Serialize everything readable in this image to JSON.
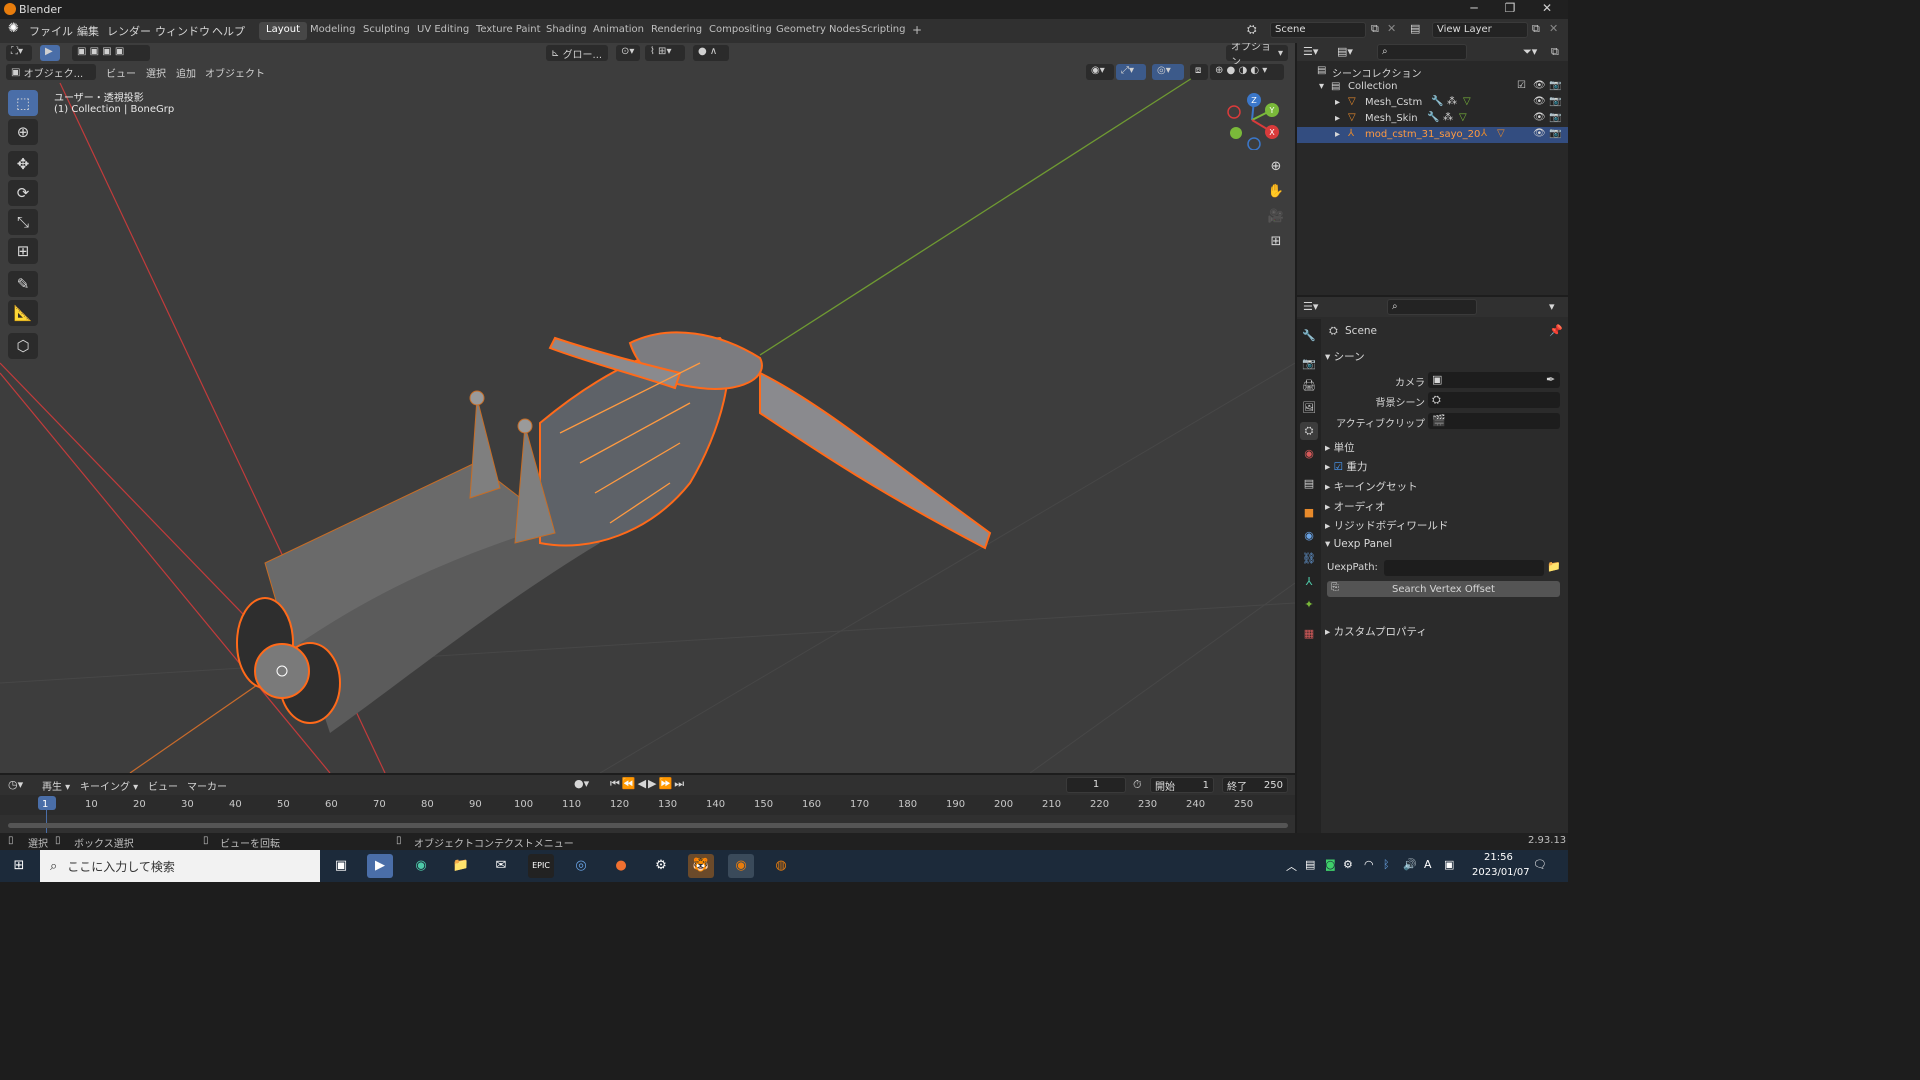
{
  "window": {
    "title": "Blender",
    "minimize": "─",
    "maximize": "❐",
    "close": "✕"
  },
  "menu": {
    "items": [
      "ファイル",
      "編集",
      "レンダー",
      "ウィンドウ",
      "ヘルプ"
    ]
  },
  "workspaces": [
    "Layout",
    "Modeling",
    "Sculpting",
    "UV Editing",
    "Texture Paint",
    "Shading",
    "Animation",
    "Rendering",
    "Compositing",
    "Geometry Nodes",
    "Scripting"
  ],
  "active_workspace": "Layout",
  "add_workspace": "+",
  "scene_field": "Scene",
  "viewlayer_field": "View Layer",
  "viewport": {
    "mode": "オブジェク...",
    "menus": [
      "ビュー",
      "選択",
      "追加",
      "オブジェクト"
    ],
    "transform_orientation": "グロー...",
    "options_label": "オプション",
    "overlay_title": "ユーザー・透視投影",
    "overlay_subtitle": "(1) Collection | BoneGrp",
    "gizmo": {
      "x": "X",
      "y": "Y",
      "z": "Z"
    }
  },
  "outliner": {
    "root": "シーンコレクション",
    "collection": "Collection",
    "objects": [
      {
        "name": "Mesh_Cstm",
        "selected": false
      },
      {
        "name": "Mesh_Skin",
        "selected": false
      },
      {
        "name": "mod_cstm_31_sayo_20",
        "selected": true
      }
    ]
  },
  "properties": {
    "header": "Scene",
    "panel_scene": "シーン",
    "camera_label": "カメラ",
    "bg_scene_label": "背景シーン",
    "active_clip_label": "アクティブクリップ",
    "sections": [
      "単位",
      "重力",
      "キーイングセット",
      "オーディオ",
      "リジッドボディワールド"
    ],
    "gravity_checked": true,
    "uexp_panel": "Uexp Panel",
    "uexp_path_label": "UexpPath:",
    "uexp_path_value": "",
    "search_button": "Search Vertex Offset",
    "custom_props": "カスタムプロパティ"
  },
  "timeline": {
    "menus": [
      "再生",
      "キーイング",
      "ビュー",
      "マーカー"
    ],
    "current_frame": "1",
    "start_label": "開始",
    "start_value": "1",
    "end_label": "終了",
    "end_value": "250",
    "ruler": [
      "1",
      "10",
      "20",
      "30",
      "40",
      "50",
      "60",
      "70",
      "80",
      "90",
      "100",
      "110",
      "120",
      "130",
      "140",
      "150",
      "160",
      "170",
      "180",
      "190",
      "200",
      "210",
      "220",
      "230",
      "240",
      "250"
    ]
  },
  "status": {
    "select": "選択",
    "box_select": "ボックス選択",
    "rotate_view": "ビューを回転",
    "context_menu": "オブジェクトコンテクストメニュー",
    "version": "2.93.13"
  },
  "taskbar": {
    "search_placeholder": "ここに入力して検索",
    "time": "21:56",
    "date": "2023/01/07",
    "ime": "A"
  },
  "colors": {
    "accent": "#4a6ea8",
    "selection_orange": "#ff8a1f",
    "axis_red": "#d93b3b",
    "axis_green": "#7ab93a",
    "viewport_bg": "#3d3d3d"
  }
}
